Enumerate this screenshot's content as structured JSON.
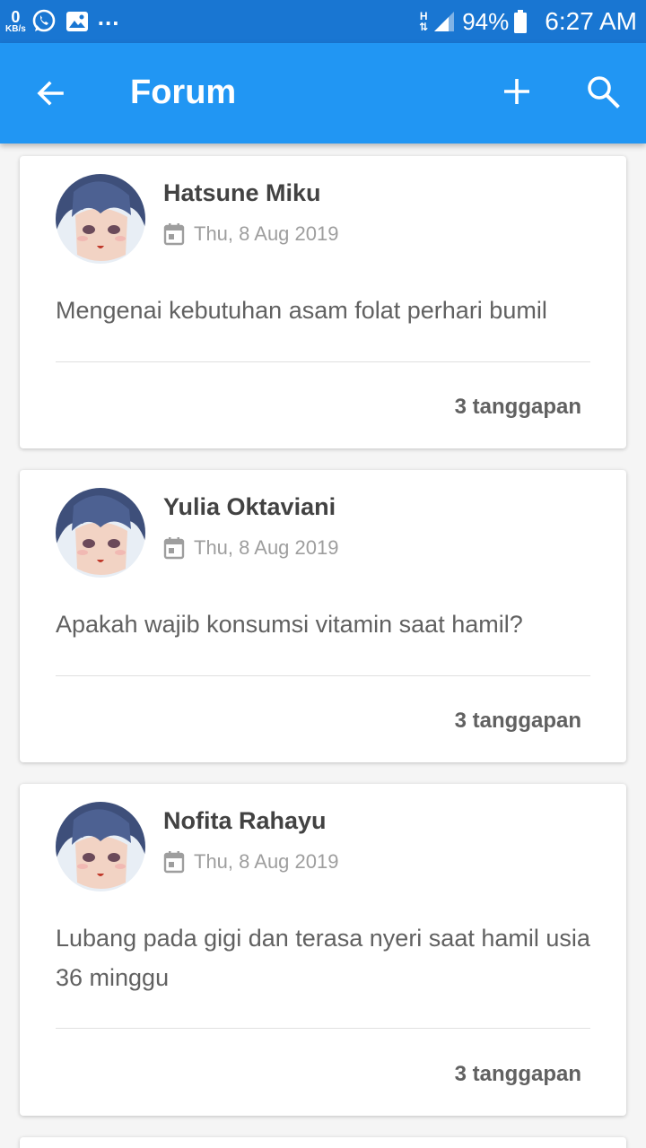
{
  "status_bar": {
    "speed_value": "0",
    "speed_unit": "KB/s",
    "more": "...",
    "network_type": "H",
    "battery": "94%",
    "time": "6:27 AM"
  },
  "app_bar": {
    "title": "Forum",
    "back_icon": "arrow-back-icon",
    "add_icon": "plus-icon",
    "search_icon": "search-icon",
    "color": "#2196f3"
  },
  "posts": [
    {
      "author": "Hatsune Miku",
      "date": "Thu, 8 Aug 2019",
      "question": "Mengenai kebutuhan asam folat perhari bumil",
      "replies": "3 tanggapan"
    },
    {
      "author": "Yulia Oktaviani",
      "date": "Thu, 8 Aug 2019",
      "question": "Apakah wajib konsumsi vitamin saat hamil?",
      "replies": "3 tanggapan"
    },
    {
      "author": "Nofita Rahayu",
      "date": "Thu, 8 Aug 2019",
      "question": "Lubang pada gigi dan terasa nyeri saat hamil usia 36 minggu",
      "replies": "3 tanggapan"
    }
  ]
}
